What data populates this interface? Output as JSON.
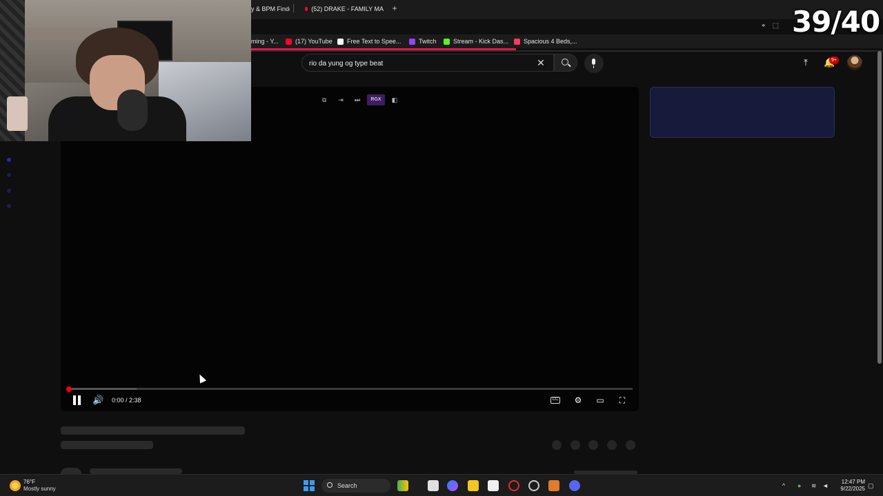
{
  "tabs": [
    {
      "label": "y & BPM Finder"
    },
    {
      "label": "(52) DRAKE - FAMILY MA"
    }
  ],
  "new_tab_label": "+",
  "bookmarks": [
    {
      "label": "ming - Y..."
    },
    {
      "label": "(17) YouTube"
    },
    {
      "label": "Free Text to Spee..."
    },
    {
      "label": "Twitch"
    },
    {
      "label": "Stream - Kick Das..."
    },
    {
      "label": "Spacious 4 Beds,..."
    }
  ],
  "counter": "39/40",
  "search": {
    "value": "rio da yung og type beat",
    "clear": "✕"
  },
  "header": {
    "notification_badge": "9+",
    "upload": "⤒",
    "bell": "🔔"
  },
  "player": {
    "time": "0:00 / 2:38",
    "progress_fraction": 0.0,
    "buffered_fraction": 0.12,
    "ext_buttons": [
      {
        "icon": "⧉",
        "name": "popout-icon"
      },
      {
        "icon": "⇥",
        "name": "enter-icon"
      },
      {
        "icon": "⏭",
        "name": "skip-icon"
      },
      {
        "icon": "RGX",
        "name": "rgx-icon"
      },
      {
        "icon": "◧",
        "name": "panel-icon"
      }
    ],
    "volume_icon": "🔊",
    "cc_label": "CC",
    "settings_icon": "⚙",
    "theater_icon": "▭",
    "fullscreen_icon": "⛶"
  },
  "weather": {
    "temp": "76°F",
    "desc": "Mostly sunny"
  },
  "taskbar": {
    "search_label": "Search"
  },
  "clock": {
    "time": "12:47 PM",
    "date": "9/22/2025"
  },
  "colors": {
    "accent": "#ff0000",
    "loadbar": "#e2174a",
    "panel": "#171a3a"
  }
}
